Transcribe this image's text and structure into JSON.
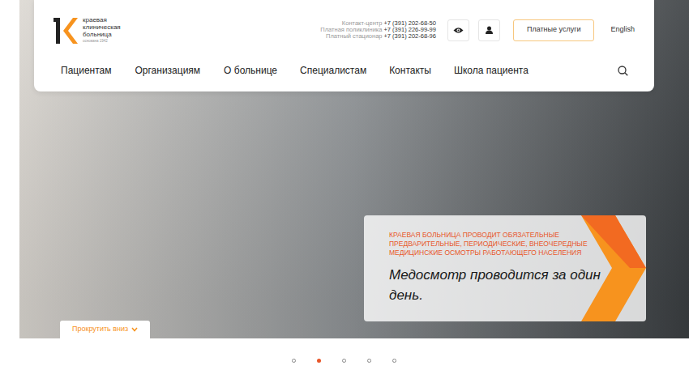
{
  "header": {
    "logo": {
      "lines": [
        "краевая",
        "клиническая",
        "больница"
      ],
      "founded": "основана 1942"
    },
    "contacts": [
      {
        "label": "Контакт-центр",
        "phone": "+7 (391) 202-68-50"
      },
      {
        "label": "Платная поликлиника",
        "phone": "+7 (391) 226-99-99"
      },
      {
        "label": "Платный стационар",
        "phone": "+7 (391) 202-68-96"
      }
    ],
    "paid_button": "Платные услуги",
    "language": "English",
    "nav": [
      "Пациентам",
      "Организациям",
      "О больнице",
      "Специалистам",
      "Контакты",
      "Школа пациента"
    ]
  },
  "slide": {
    "kicker": "КРАЕВАЯ БОЛЬНИЦА ПРОВОДИТ ОБЯЗАТЕЛЬНЫЕ ПРЕДВАРИТЕЛЬНЫЕ, ПЕРИОДИЧЕСКИЕ, ВНЕОЧЕРЕДНЫЕ МЕДИЦИНСКИЕ ОСМОТРЫ РАБОТАЮЩЕГО НАСЕЛЕНИЯ",
    "title": "Медосмотр проводится за один день."
  },
  "scroll_button": "Прокрутить вниз",
  "dots": [
    {
      "selected": false
    },
    {
      "selected": true
    },
    {
      "selected": false
    },
    {
      "selected": false
    },
    {
      "selected": false
    }
  ]
}
